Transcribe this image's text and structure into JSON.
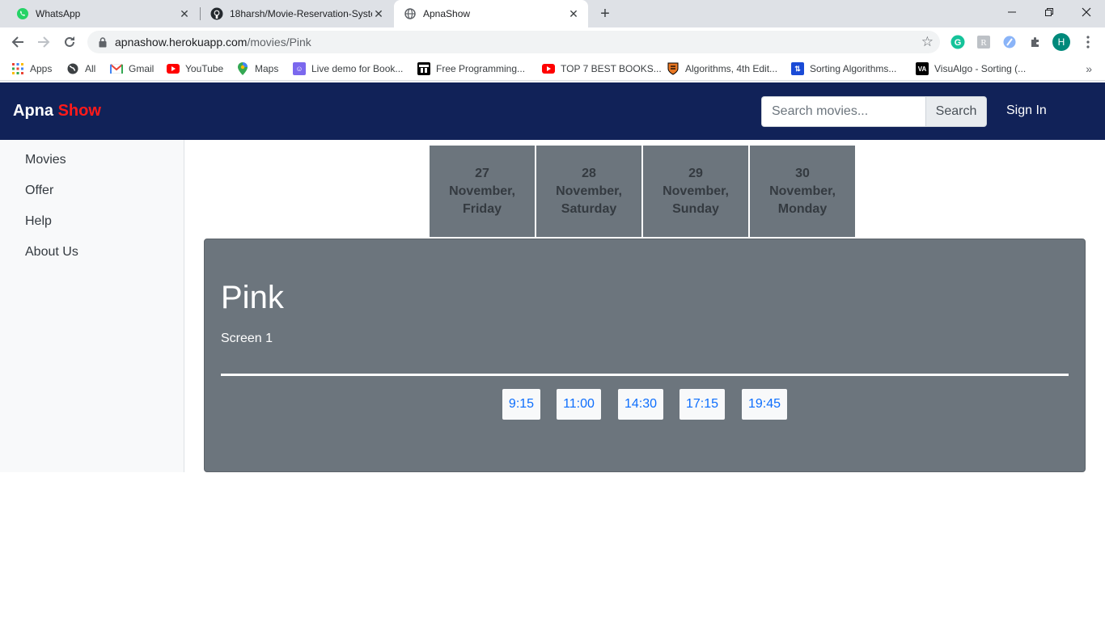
{
  "browser": {
    "tabs": [
      {
        "title": "WhatsApp",
        "icon": "whatsapp-icon"
      },
      {
        "title": "18harsh/Movie-Reservation-Syste",
        "icon": "github-icon"
      },
      {
        "title": "ApnaShow",
        "icon": "globe-icon"
      }
    ],
    "new_tab_label": "+",
    "url_host": "apnashow.herokuapp.com",
    "url_path": "/movies/Pink",
    "profile_initial": "H",
    "bookmarks": [
      {
        "label": "Apps",
        "icon": "apps-grid-icon"
      },
      {
        "label": "All",
        "icon": "globe-icon"
      },
      {
        "label": "Gmail",
        "icon": "gmail-icon"
      },
      {
        "label": "YouTube",
        "icon": "youtube-icon"
      },
      {
        "label": "Maps",
        "icon": "maps-pin-icon"
      },
      {
        "label": "Live demo for Book...",
        "icon": "live-demo-icon"
      },
      {
        "label": "Free Programming...",
        "icon": "programming-icon"
      },
      {
        "label": "TOP 7 BEST BOOKS...",
        "icon": "youtube-icon"
      },
      {
        "label": "Algorithms, 4th Edit...",
        "icon": "princeton-shield-icon"
      },
      {
        "label": "Sorting Algorithms...",
        "icon": "sorting-icon"
      },
      {
        "label": "VisuAlgo - Sorting (...",
        "icon": "visualgo-icon"
      }
    ]
  },
  "site": {
    "brand_first": "Apna",
    "brand_second": "Show",
    "brand_color": "#ff1a1a",
    "nav_color": "#112258",
    "search_placeholder": "Search movies...",
    "search_button": "Search",
    "sign_in": "Sign In"
  },
  "sidebar": {
    "items": [
      {
        "label": "Movies"
      },
      {
        "label": "Offer"
      },
      {
        "label": "Help"
      },
      {
        "label": "About Us"
      }
    ]
  },
  "dates": [
    {
      "day": "27",
      "month": "November,",
      "weekday": "Friday"
    },
    {
      "day": "28",
      "month": "November,",
      "weekday": "Saturday"
    },
    {
      "day": "29",
      "month": "November,",
      "weekday": "Sunday"
    },
    {
      "day": "30",
      "month": "November,",
      "weekday": "Monday"
    }
  ],
  "show": {
    "movie": "Pink",
    "screen": "Screen 1",
    "times": [
      "9:15",
      "11:00",
      "14:30",
      "17:15",
      "19:45"
    ]
  }
}
